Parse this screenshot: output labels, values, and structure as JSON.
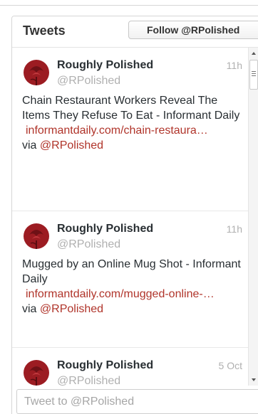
{
  "header": {
    "title": "Tweets",
    "follow_label": "Follow @RPolished"
  },
  "tweets": [
    {
      "author_name": "Roughly Polished",
      "handle": "@RPolished",
      "time": "11h",
      "text": "Chain Restaurant Workers Reveal The Items They Refuse To Eat - Informant Daily",
      "url": "informantdaily.com/chain-restaura…",
      "via_label": "via",
      "via_handle": "@RPolished"
    },
    {
      "author_name": "Roughly Polished",
      "handle": "@RPolished",
      "time": "11h",
      "text": "Mugged by an Online Mug Shot - Informant Daily",
      "url": "informantdaily.com/mugged-online-…",
      "via_label": "via",
      "via_handle": "@RPolished"
    },
    {
      "author_name": "Roughly Polished",
      "handle": "@RPolished",
      "time": "5 Oct"
    }
  ],
  "compose": {
    "placeholder": "Tweet to @RPolished"
  },
  "colors": {
    "link": "#b0342a",
    "avatar": "#9c1c22",
    "muted": "#b0b0b0"
  },
  "icons": {
    "avatar": "red-rose-icon",
    "scroll_up": "arrow-up-icon",
    "scroll_down": "arrow-down-icon"
  }
}
